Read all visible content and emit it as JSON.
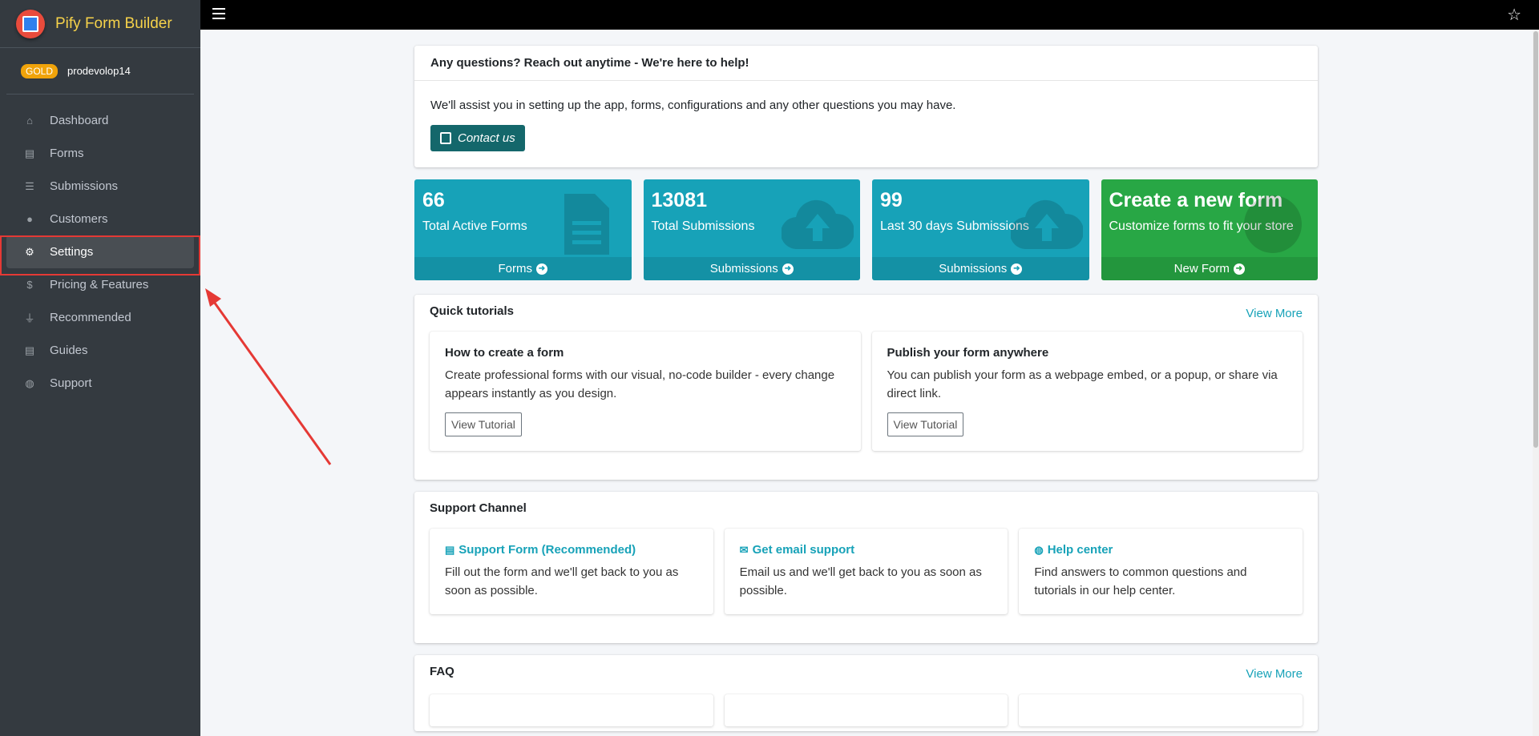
{
  "brand": {
    "name": "Pify Form Builder"
  },
  "user": {
    "badge": "GOLD",
    "name": "prodevolop14"
  },
  "sidebar": {
    "items": [
      {
        "label": "Dashboard",
        "icon": "home-icon",
        "glyph": "⌂"
      },
      {
        "label": "Forms",
        "icon": "file-icon",
        "glyph": "▤"
      },
      {
        "label": "Submissions",
        "icon": "list-icon",
        "glyph": "☰"
      },
      {
        "label": "Customers",
        "icon": "user-icon",
        "glyph": "●"
      },
      {
        "label": "Settings",
        "icon": "gear-icon",
        "glyph": "⚙"
      },
      {
        "label": "Pricing & Features",
        "icon": "dollar-icon",
        "glyph": "$"
      },
      {
        "label": "Recommended",
        "icon": "plug-icon",
        "glyph": "⏚"
      },
      {
        "label": "Guides",
        "icon": "book-icon",
        "glyph": "▤"
      },
      {
        "label": "Support",
        "icon": "support-icon",
        "glyph": "◍"
      }
    ],
    "active": "Settings"
  },
  "help": {
    "title": "Any questions? Reach out anytime - We're here to help!",
    "text": "We'll assist you in setting up the app, forms, configurations and any other questions you may have.",
    "button": "Contact us"
  },
  "stats": [
    {
      "value": "66",
      "label": "Total Active Forms",
      "link": "Forms",
      "icon": "file-icon",
      "color": "#17a2b8"
    },
    {
      "value": "13081",
      "label": "Total Submissions",
      "link": "Submissions",
      "icon": "cloud-upload-icon",
      "color": "#17a2b8"
    },
    {
      "value": "99",
      "label": "Last 30 days Submissions",
      "link": "Submissions",
      "icon": "cloud-upload-icon",
      "color": "#17a2b8"
    },
    {
      "value": "Create a new form",
      "label": "Customize forms to fit your store",
      "link": "New Form",
      "icon": "plus-circle-icon",
      "color": "#28a745"
    }
  ],
  "tutorials": {
    "title": "Quick tutorials",
    "view_more": "View More",
    "items": [
      {
        "title": "How to create a form",
        "text": "Create professional forms with our visual, no-code builder - every change appears instantly as you design.",
        "button": "View Tutorial"
      },
      {
        "title": "Publish your form anywhere",
        "text": "You can publish your form as a webpage embed, or a popup, or share via direct link.",
        "button": "View Tutorial"
      }
    ]
  },
  "support": {
    "title": "Support Channel",
    "items": [
      {
        "title": "Support Form (Recommended)",
        "text": "Fill out the form and we'll get back to you as soon as possible.",
        "icon": "file-icon"
      },
      {
        "title": "Get email support",
        "text": "Email us and we'll get back to you as soon as possible.",
        "icon": "envelope-icon"
      },
      {
        "title": "Help center",
        "text": "Find answers to common questions and tutorials in our help center.",
        "icon": "globe-icon"
      }
    ]
  },
  "faq": {
    "title": "FAQ",
    "view_more": "View More"
  }
}
